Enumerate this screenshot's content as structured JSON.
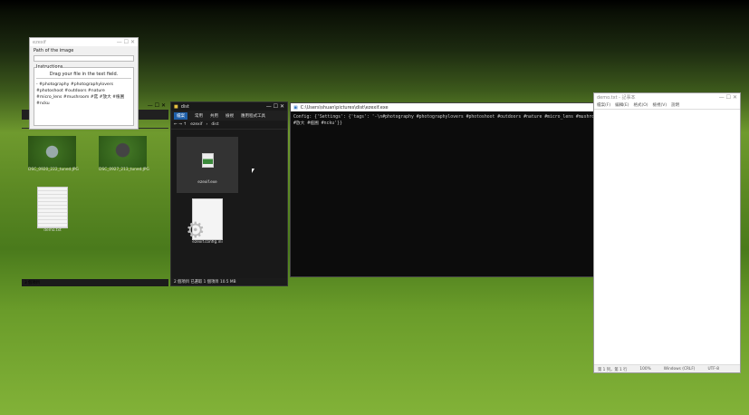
{
  "ezexif": {
    "title": "ezexif",
    "path_label": "Path of the image",
    "path_value": "",
    "instructions_label": "Instructions",
    "drag_hint": "Drag your file in the text field.",
    "tags_text": "- #photography #photographylovers #photoshoot #outdoors #nature #micro_lens #mushroom #菇 #放大 #植圃 #ncku"
  },
  "explorer1": {
    "files": [
      {
        "name": "DSC_0920_222_tuned.JPG"
      },
      {
        "name": "DSC_0927_213_tuned.JPG"
      },
      {
        "name": "demo.txt"
      }
    ],
    "status": "3 個項目"
  },
  "explorer2": {
    "title": "dist",
    "tabs": [
      "檔案",
      "常用",
      "共用",
      "檢視",
      "應用程式工具"
    ],
    "breadcrumb": [
      "ezexif",
      "dist"
    ],
    "files": [
      {
        "name": "ezexif.exe"
      },
      {
        "name": "ezexif.config.ini"
      }
    ],
    "status": "2 個項目  已選取 1 個項目 10.5 MB"
  },
  "console": {
    "title": "C:\\Users\\shuan\\pictures\\dist\\ezexif.exe",
    "output": "Config: {'Settings': {'tags': '-\\n#photography #photographylovers #photoshoot #outdoors #nature #micro_lens #mushroom #菇 #放大 #植圃 #ncku'}}"
  },
  "notepad": {
    "title": "demo.txt - 記事本",
    "menu": [
      "檔案(F)",
      "編輯(E)",
      "格式(O)",
      "檢視(V)",
      "說明"
    ],
    "status": {
      "pos": "第 1 列，第 1 行",
      "zoom": "100%",
      "eol": "Windows (CRLF)",
      "enc": "UTF-8"
    }
  }
}
